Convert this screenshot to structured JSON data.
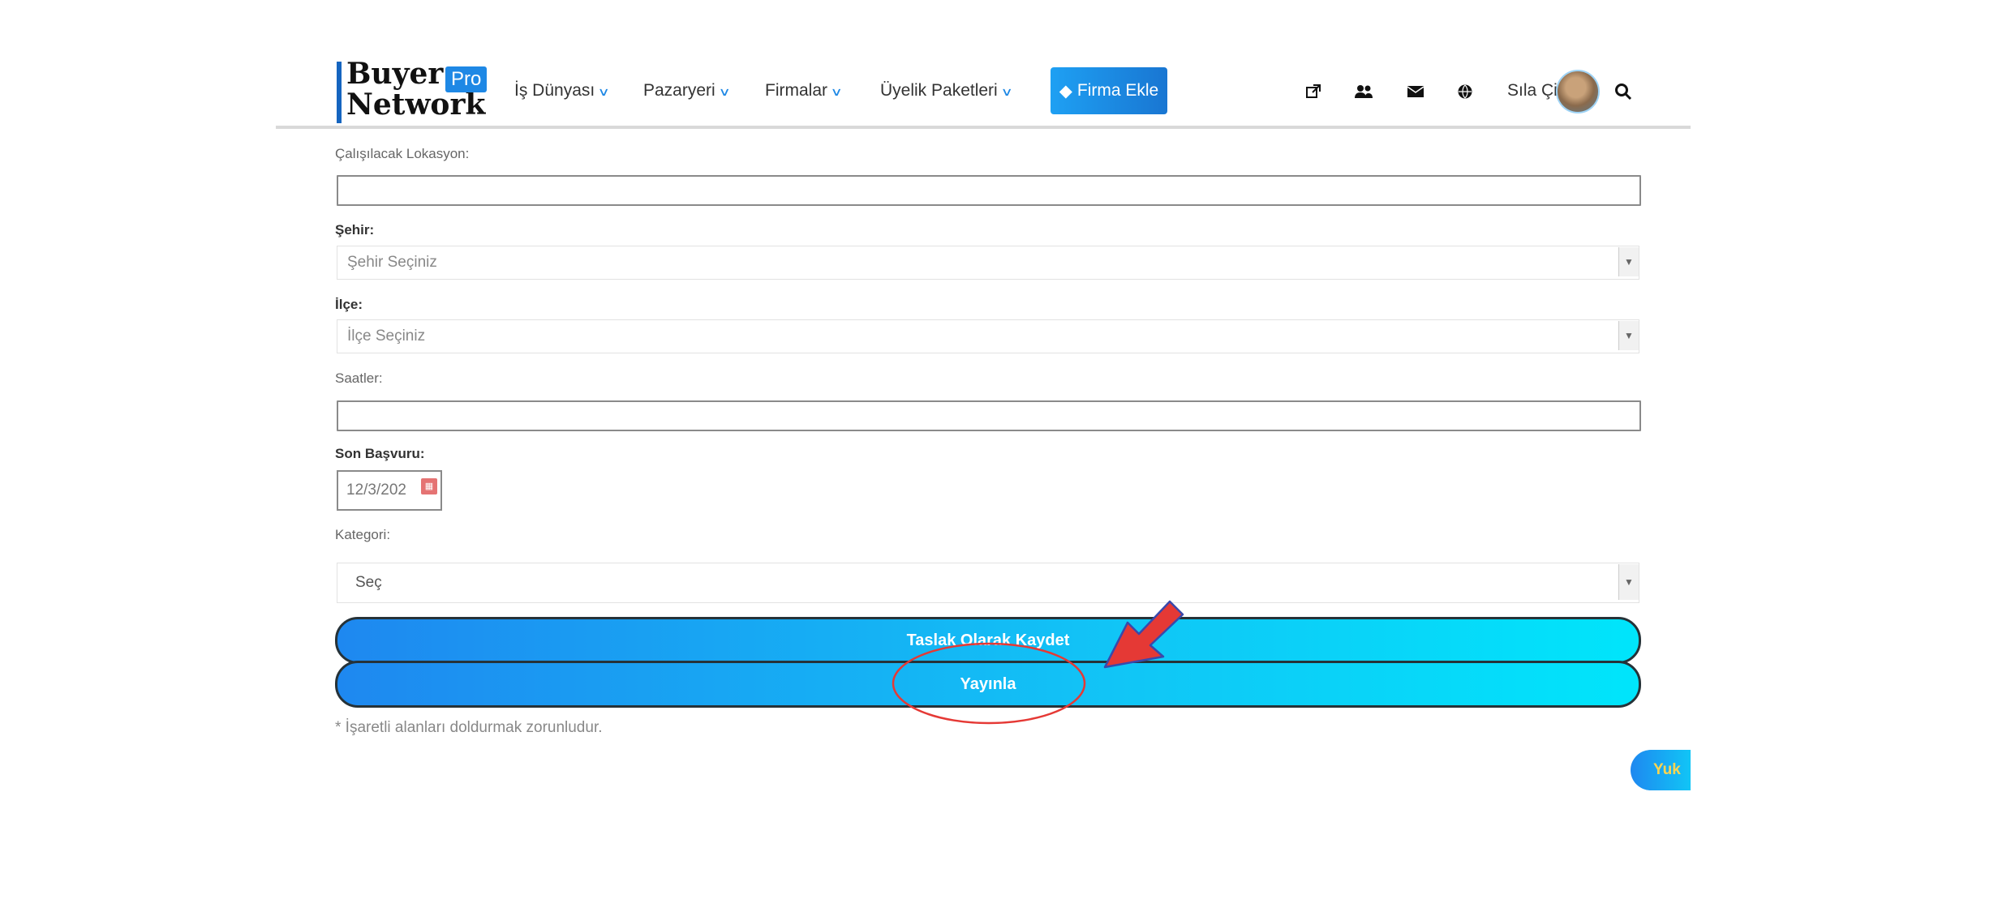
{
  "header": {
    "logo": {
      "line1": "Buyer",
      "line2": "Network",
      "badge": "Pro"
    },
    "nav": [
      {
        "label": "İş Dünyası"
      },
      {
        "label": "Pazaryeri"
      },
      {
        "label": "Firmalar"
      },
      {
        "label": "Üyelik Paketleri"
      }
    ],
    "cta_label": "Firma Ekle",
    "icons": [
      "external-link-icon",
      "users-icon",
      "envelope-icon",
      "globe-icon",
      "search-icon"
    ],
    "user_name": "Sıla Çil"
  },
  "form": {
    "location_label": "Çalışılacak Lokasyon:",
    "location_value": "",
    "city_label": "Şehir:",
    "city_value": "Şehir Seçiniz",
    "district_label": "İlçe:",
    "district_value": "İlçe Seçiniz",
    "hours_label": "Saatler:",
    "hours_value": "",
    "deadline_label": "Son Başvuru:",
    "deadline_value": "12/3/202",
    "category_label": "Kategori:",
    "category_value": "Seç"
  },
  "actions": {
    "draft_label": "Taslak Olarak Kaydet",
    "publish_label": "Yayınla"
  },
  "note": "* İşaretli alanları doldurmak zorunludur.",
  "scroll_top_label": "Yuk",
  "colors": {
    "accent": "#1e88e5",
    "button_gradient_end": "#00e5fb",
    "annotation": "#e53935"
  }
}
